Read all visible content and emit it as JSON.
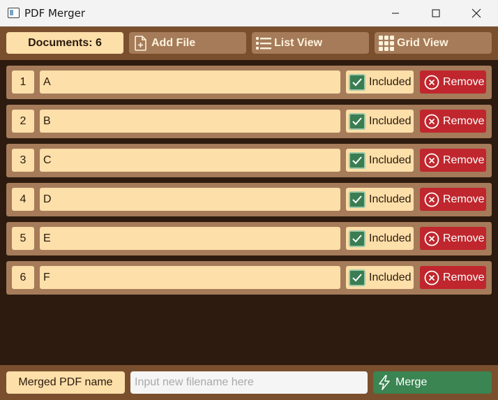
{
  "window": {
    "title": "PDF Merger"
  },
  "toolbar": {
    "document_count": "Documents: 6",
    "add_file_label": "Add File",
    "list_view_label": "List View",
    "grid_view_label": "Grid View"
  },
  "documents": [
    {
      "index": "1",
      "name": "A",
      "status": "Included",
      "remove_label": "Remove"
    },
    {
      "index": "2",
      "name": "B",
      "status": "Included",
      "remove_label": "Remove"
    },
    {
      "index": "3",
      "name": "C",
      "status": "Included",
      "remove_label": "Remove"
    },
    {
      "index": "4",
      "name": "D",
      "status": "Included",
      "remove_label": "Remove"
    },
    {
      "index": "5",
      "name": "E",
      "status": "Included",
      "remove_label": "Remove"
    },
    {
      "index": "6",
      "name": "F",
      "status": "Included",
      "remove_label": "Remove"
    }
  ],
  "footer": {
    "name_label": "Merged PDF name",
    "filename_value": "",
    "filename_placeholder": "Input new filename here",
    "merge_label": "Merge"
  },
  "icons": {
    "add_file": "file-plus-icon",
    "list_view": "list-icon",
    "grid_view": "grid-icon",
    "included": "checkbox-checked-icon",
    "remove": "close-circle-icon",
    "merge": "lightning-icon"
  },
  "colors": {
    "background": "#2d1b0f",
    "toolbar": "#7a4f2e",
    "row": "#a57b5a",
    "field": "#fddfa9",
    "remove": "#c0262d",
    "merge": "#3a8552",
    "check": "#3a7d52"
  }
}
